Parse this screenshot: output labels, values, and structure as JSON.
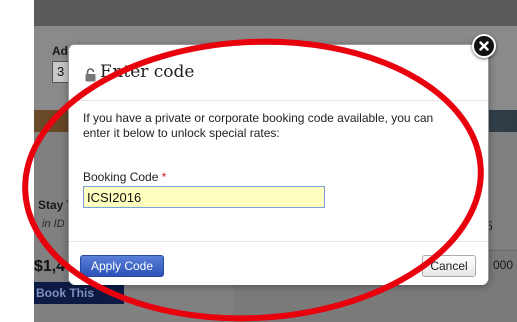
{
  "background": {
    "label_fragment": "Ad",
    "select_value": "3",
    "stay_fragment": "Stay T",
    "in_fragment": "in ID",
    "price_fragment": "$1,4",
    "book_fragment": "Book This",
    "col_value": "5",
    "price_right_fragment": "000"
  },
  "modal": {
    "title": "Enter code",
    "title_icon": "lock-icon",
    "intro_text": "If you have a private or corporate booking code available, you can enter it below to unlock special rates:",
    "field_label": "Booking Code",
    "required_mark": "*",
    "code_value": "ICSI2016",
    "apply_label": "Apply Code",
    "cancel_label": "Cancel",
    "close_icon": "close-icon"
  },
  "colors": {
    "annotation": "#e8000d",
    "primary_button": "#2b52b8",
    "input_bg": "#ffffc0"
  }
}
